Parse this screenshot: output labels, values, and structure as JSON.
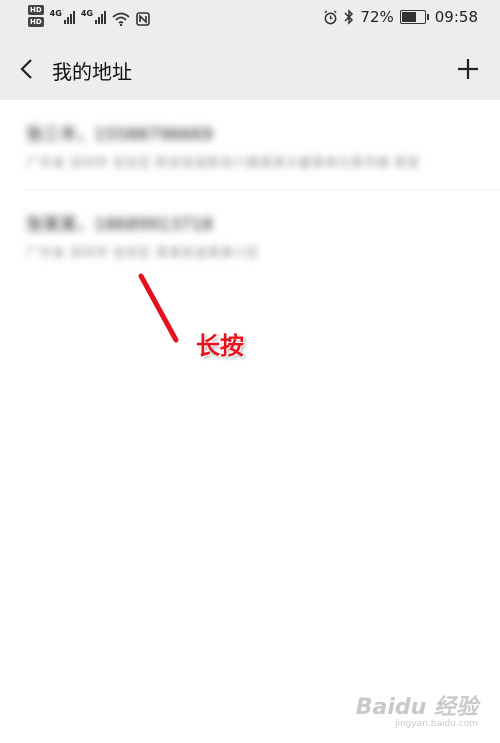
{
  "status_bar": {
    "hd_badges": [
      "HD",
      "HD"
    ],
    "network_labels": [
      "4G",
      "4G"
    ],
    "battery_percent": "72%",
    "battery_level": 0.72,
    "time": "09:58",
    "icons": [
      "hd-icon",
      "signal-icon",
      "wifi-icon",
      "nfc-icon",
      "alarm-icon",
      "bluetooth-icon",
      "battery-icon"
    ]
  },
  "header": {
    "title": "我的地址",
    "back_icon": "chevron-left-icon",
    "add_icon": "plus-icon"
  },
  "addresses": [
    {
      "title": "张三丰，15588796669",
      "subtitle": "广东省 深圳市 宝安区 新安街道新安六路某某大厦某单元某号楼 某室"
    },
    {
      "title": "张某某，18689913718",
      "subtitle": "广东省 深圳市 宝安区 某某街道某某小区"
    }
  ],
  "annotation": {
    "label": "长按",
    "color": "#e8101c"
  },
  "watermark": {
    "logo": "Baidu 经验",
    "url": "jingyan.baidu.com"
  }
}
